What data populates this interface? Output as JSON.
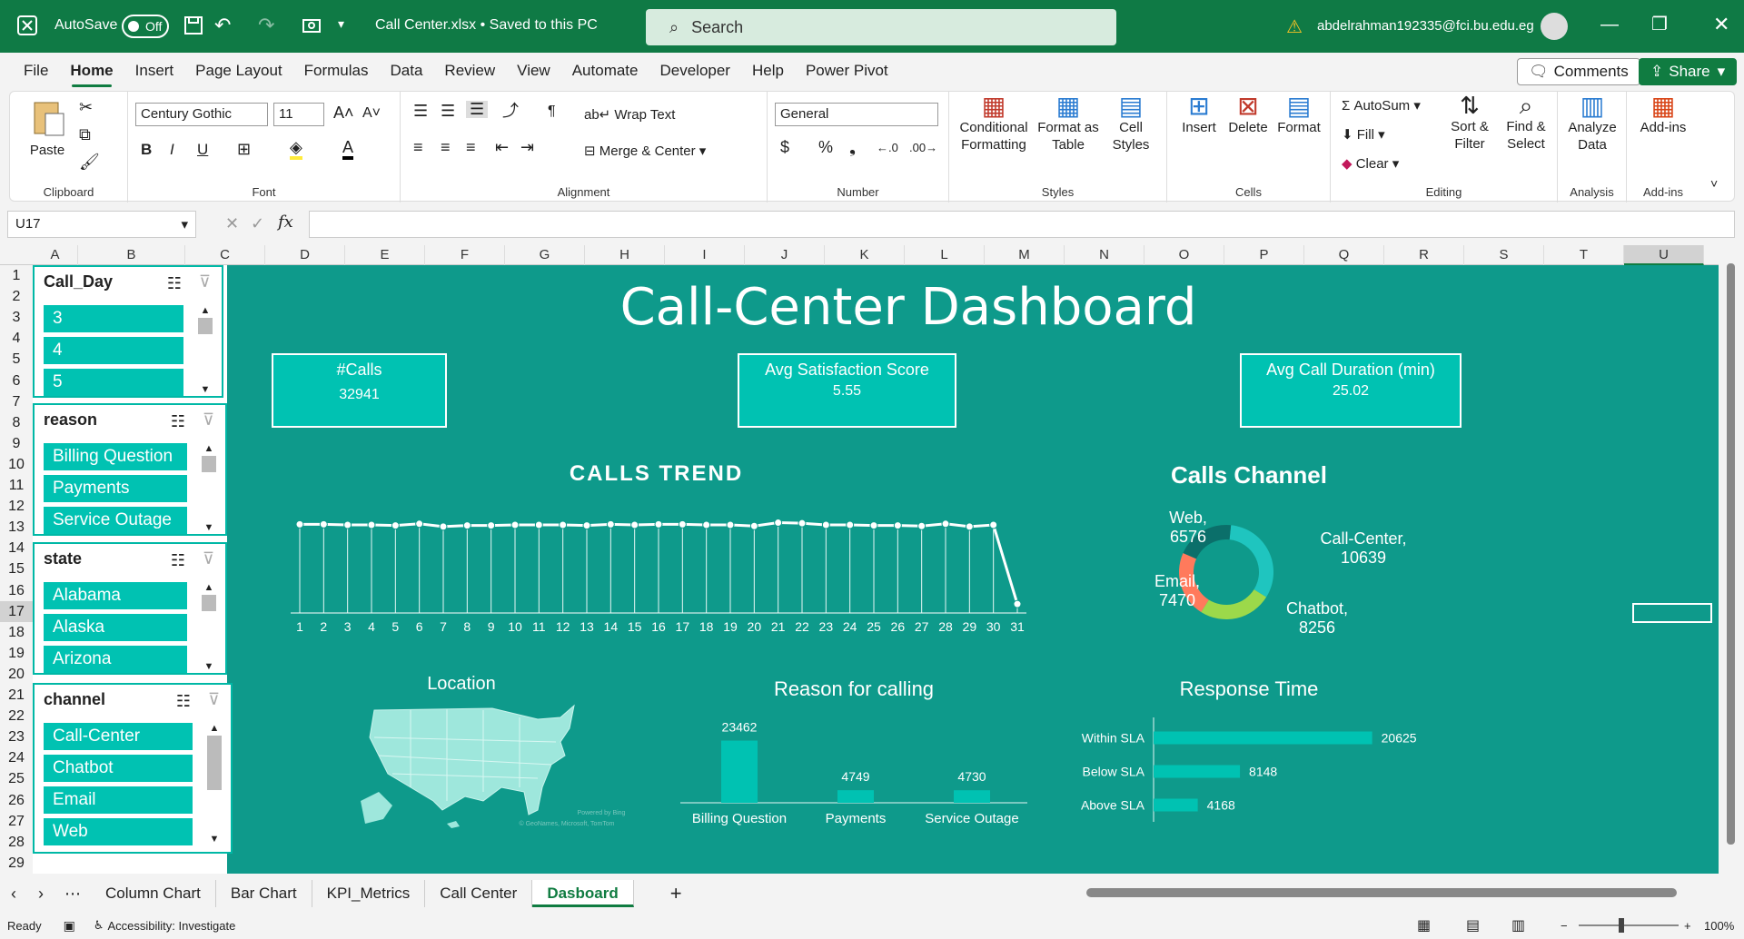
{
  "titlebar": {
    "autosave_label": "AutoSave",
    "autosave_state": "Off",
    "filename": "Call Center.xlsx • Saved to this PC",
    "search_placeholder": "Search",
    "user_email": "abdelrahman192335@fci.bu.edu.eg"
  },
  "menu": {
    "items": [
      "File",
      "Home",
      "Insert",
      "Page Layout",
      "Formulas",
      "Data",
      "Review",
      "View",
      "Automate",
      "Developer",
      "Help",
      "Power Pivot"
    ],
    "active": "Home",
    "comments_label": "Comments",
    "share_label": "Share"
  },
  "ribbon": {
    "clipboard": {
      "paste": "Paste",
      "label": "Clipboard"
    },
    "font": {
      "name": "Century Gothic",
      "size": "11",
      "label": "Font"
    },
    "alignment": {
      "wrap_text": "Wrap Text",
      "merge_center": "Merge & Center",
      "label": "Alignment"
    },
    "number": {
      "format": "General",
      "label": "Number"
    },
    "styles": {
      "conditional": "Conditional Formatting",
      "format_table": "Format as Table",
      "cell_styles": "Cell Styles",
      "label": "Styles"
    },
    "cells": {
      "insert": "Insert",
      "delete": "Delete",
      "format": "Format",
      "label": "Cells"
    },
    "editing": {
      "autosum": "AutoSum",
      "fill": "Fill",
      "clear": "Clear",
      "sort_filter": "Sort & Filter",
      "find_select": "Find & Select",
      "label": "Editing"
    },
    "analysis": {
      "analyze_data": "Analyze Data",
      "label": "Analysis"
    },
    "addins": {
      "addins": "Add-ins",
      "label": "Add-ins"
    }
  },
  "formula_bar": {
    "name_box": "U17",
    "fx": "fx",
    "formula": ""
  },
  "columns": [
    "A",
    "B",
    "C",
    "D",
    "E",
    "F",
    "G",
    "H",
    "I",
    "J",
    "K",
    "L",
    "M",
    "N",
    "O",
    "P",
    "Q",
    "R",
    "S",
    "T",
    "U"
  ],
  "rows": [
    "1",
    "2",
    "3",
    "4",
    "5",
    "6",
    "7",
    "8",
    "9",
    "10",
    "11",
    "12",
    "13",
    "14",
    "15",
    "16",
    "17",
    "18",
    "19",
    "20",
    "21",
    "22",
    "23",
    "24",
    "25",
    "26",
    "27",
    "28",
    "29"
  ],
  "slicers": [
    {
      "title": "Call_Day",
      "items": [
        "3",
        "4",
        "5"
      ]
    },
    {
      "title": "reason",
      "items": [
        "Billing Question",
        "Payments",
        "Service Outage"
      ]
    },
    {
      "title": "state",
      "items": [
        "Alabama",
        "Alaska",
        "Arizona"
      ]
    },
    {
      "title": "channel",
      "items": [
        "Call-Center",
        "Chatbot",
        "Email",
        "Web"
      ]
    }
  ],
  "dashboard": {
    "title": "Call-Center Dashboard",
    "kpis": [
      {
        "label": "#Calls",
        "value": "32941"
      },
      {
        "label": "Avg Satisfaction Score",
        "value": "5.55"
      },
      {
        "label": "Avg Call Duration (min)",
        "value": "25.02"
      }
    ],
    "location_title": "Location",
    "map_credit_1": "Powered by Bing",
    "map_credit_2": "© GeoNames, Microsoft, TomTom"
  },
  "chart_data": [
    {
      "type": "line",
      "title": "CALLS TREND",
      "x": [
        1,
        2,
        3,
        4,
        5,
        6,
        7,
        8,
        9,
        10,
        11,
        12,
        13,
        14,
        15,
        16,
        17,
        18,
        19,
        20,
        21,
        22,
        23,
        24,
        25,
        26,
        27,
        28,
        29,
        30,
        31
      ],
      "values": [
        1090,
        1090,
        1085,
        1085,
        1080,
        1095,
        1070,
        1080,
        1080,
        1085,
        1085,
        1085,
        1080,
        1090,
        1085,
        1090,
        1090,
        1085,
        1085,
        1075,
        1105,
        1100,
        1085,
        1085,
        1080,
        1080,
        1075,
        1095,
        1070,
        1085,
        380
      ],
      "ylim": [
        300,
        1150
      ]
    },
    {
      "type": "pie",
      "title": "Calls Channel",
      "labels": [
        "Call-Center",
        "Chatbot",
        "Email",
        "Web"
      ],
      "values": [
        10639,
        8256,
        7470,
        6576
      ],
      "colors": [
        "#1fc5bf",
        "#9cd94a",
        "#ff7a5c",
        "#0b6f6a"
      ]
    },
    {
      "type": "bar",
      "title": "Reason for calling",
      "categories": [
        "Billing Question",
        "Payments",
        "Service Outage"
      ],
      "values": [
        23462,
        4749,
        4730
      ],
      "ylim": [
        0,
        24000
      ]
    },
    {
      "type": "bar",
      "title": "Response Time",
      "orientation": "horizontal",
      "categories": [
        "Within SLA",
        "Below SLA",
        "Above SLA"
      ],
      "values": [
        20625,
        8148,
        4168
      ],
      "xlim": [
        0,
        21000
      ]
    }
  ],
  "tabs": {
    "items": [
      "Column Chart",
      "Bar Chart",
      "KPI_Metrics",
      "Call Center",
      "Dasboard"
    ],
    "active": "Dasboard"
  },
  "status": {
    "ready": "Ready",
    "accessibility": "Accessibility: Investigate",
    "zoom": "100%"
  }
}
